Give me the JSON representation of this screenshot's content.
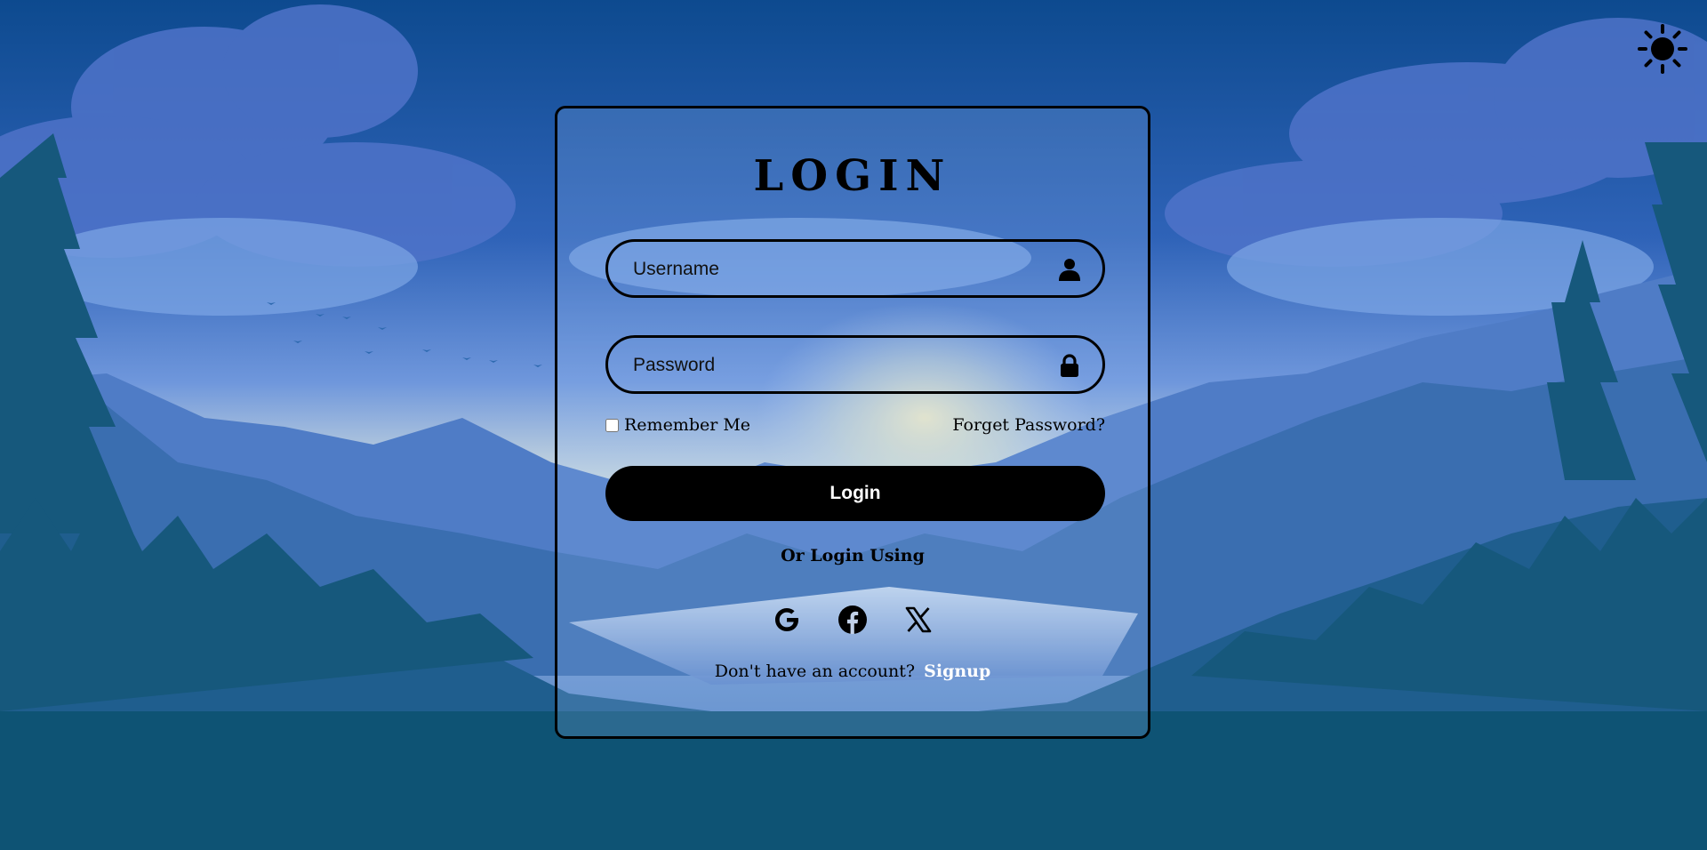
{
  "theme": {
    "toggle_icon": "sun-icon"
  },
  "login": {
    "title": "LOGIN",
    "username": {
      "placeholder": "Username",
      "value": "",
      "icon": "user-icon"
    },
    "password": {
      "placeholder": "Password",
      "value": "",
      "icon": "lock-icon"
    },
    "remember_label": "Remember Me",
    "remember_checked": false,
    "forgot_label": "Forget Password?",
    "submit_label": "Login",
    "alt_login_label": "Or Login Using",
    "social_icons": [
      "google-icon",
      "facebook-icon",
      "x-icon"
    ],
    "signup_prompt": "Don't have an account?",
    "signup_label": "Signup"
  },
  "colors": {
    "card_border": "#000000",
    "button_bg": "#000000",
    "button_text": "#ffffff",
    "signup_link": "#ffffff",
    "sky_top": "#0d4a8f",
    "forest": "#0e5374"
  }
}
